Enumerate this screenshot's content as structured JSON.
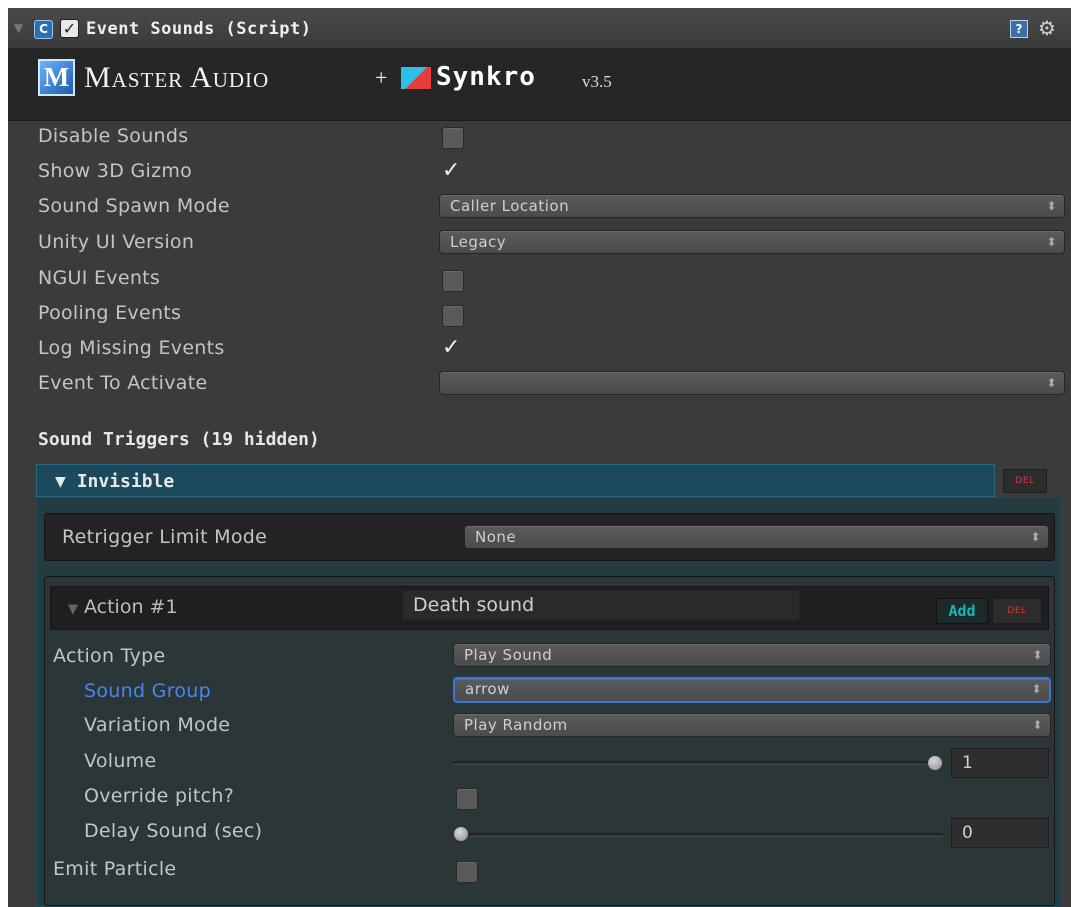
{
  "header": {
    "title": "Event Sounds (Script)",
    "script_icon": "csharp-script-icon",
    "enabled": true,
    "help_icon": "help-icon",
    "gear_icon": "gear-icon"
  },
  "logo": {
    "brand": "Master Audio",
    "plus": "+",
    "partner": "Synkro",
    "version": "v3.5"
  },
  "properties": {
    "disable_sounds": {
      "label": "Disable Sounds",
      "checked": false
    },
    "show_3d_gizmo": {
      "label": "Show 3D Gizmo",
      "checked": true
    },
    "sound_spawn_mode": {
      "label": "Sound Spawn Mode",
      "value": "Caller Location"
    },
    "unity_ui_version": {
      "label": "Unity UI Version",
      "value": "Legacy"
    },
    "ngui_events": {
      "label": "NGUI Events",
      "checked": false
    },
    "pooling_events": {
      "label": "Pooling Events",
      "checked": false
    },
    "log_missing_events": {
      "label": "Log Missing Events",
      "checked": true
    },
    "event_to_activate": {
      "label": "Event To Activate",
      "value": ""
    }
  },
  "sound_triggers": {
    "title": "Sound Triggers (19 hidden)",
    "trigger": {
      "name": "Invisible",
      "del_label": "DEL",
      "retrigger_limit_mode": {
        "label": "Retrigger Limit Mode",
        "value": "None"
      },
      "action": {
        "label": "Action #1",
        "name": "Death sound",
        "add_label": "Add",
        "del_label": "DEL",
        "action_type": {
          "label": "Action Type",
          "value": "Play Sound"
        },
        "sound_group": {
          "label": "Sound Group",
          "value": "arrow"
        },
        "variation_mode": {
          "label": "Variation Mode",
          "value": "Play Random"
        },
        "volume": {
          "label": "Volume",
          "value": "1",
          "fraction": 1.0
        },
        "override_pitch": {
          "label": "Override pitch?",
          "checked": false
        },
        "delay_sound": {
          "label": "Delay Sound (sec)",
          "value": "0",
          "fraction": 0.0
        },
        "emit_particle": {
          "label": "Emit Particle",
          "checked": false
        }
      }
    }
  },
  "colors": {
    "panel_bg": "#3b3b3b",
    "trigger_header": "#1c4a5c",
    "trigger_body": "#233c42",
    "highlight_label": "#4a86e8",
    "add_text": "#19b8b8",
    "del_text": "#d63a3a"
  }
}
